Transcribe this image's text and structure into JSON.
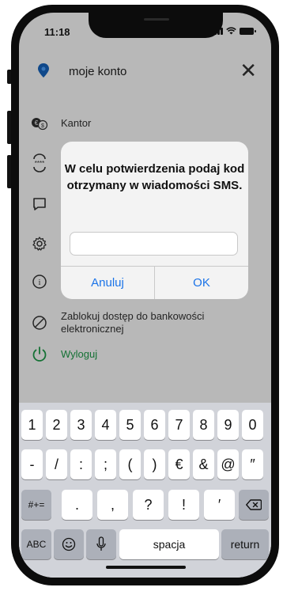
{
  "status": {
    "time": "11:18"
  },
  "header": {
    "title": "moje konto",
    "close_glyph": "✕"
  },
  "menu": {
    "items": [
      {
        "label": "Kantor",
        "icon": "currency-exchange-icon"
      },
      {
        "label": "",
        "icon": "password-icon"
      },
      {
        "label": "",
        "icon": "message-icon"
      },
      {
        "label": "",
        "icon": "settings-icon"
      },
      {
        "label": "",
        "icon": "info-icon"
      },
      {
        "label": "Zablokuj dostęp do bankowości elektronicznej",
        "icon": "block-icon"
      },
      {
        "label": "Wyloguj",
        "icon": "power-icon"
      }
    ]
  },
  "dialog": {
    "message": "W celu potwierdzenia podaj kod otrzymany w wiadomości SMS.",
    "input_value": "",
    "cancel_label": "Anuluj",
    "ok_label": "OK"
  },
  "keyboard": {
    "row1": [
      "1",
      "2",
      "3",
      "4",
      "5",
      "6",
      "7",
      "8",
      "9",
      "0"
    ],
    "row2": [
      "-",
      "/",
      ":",
      ";",
      "(",
      ")",
      "€",
      "&",
      "@",
      "″"
    ],
    "row3_left": "#+=",
    "row3": [
      ".",
      ",",
      "?",
      "!",
      "′"
    ],
    "row3_right_icon": "backspace-icon",
    "row4_left": "ABC",
    "emoji_icon": "emoji-icon",
    "mic_icon": "microphone-icon",
    "space_label": "spacja",
    "return_label": "return"
  },
  "colors": {
    "accent": "#1a73e8",
    "logout_green": "#1e9e4a",
    "pin_blue": "#1565c0"
  }
}
